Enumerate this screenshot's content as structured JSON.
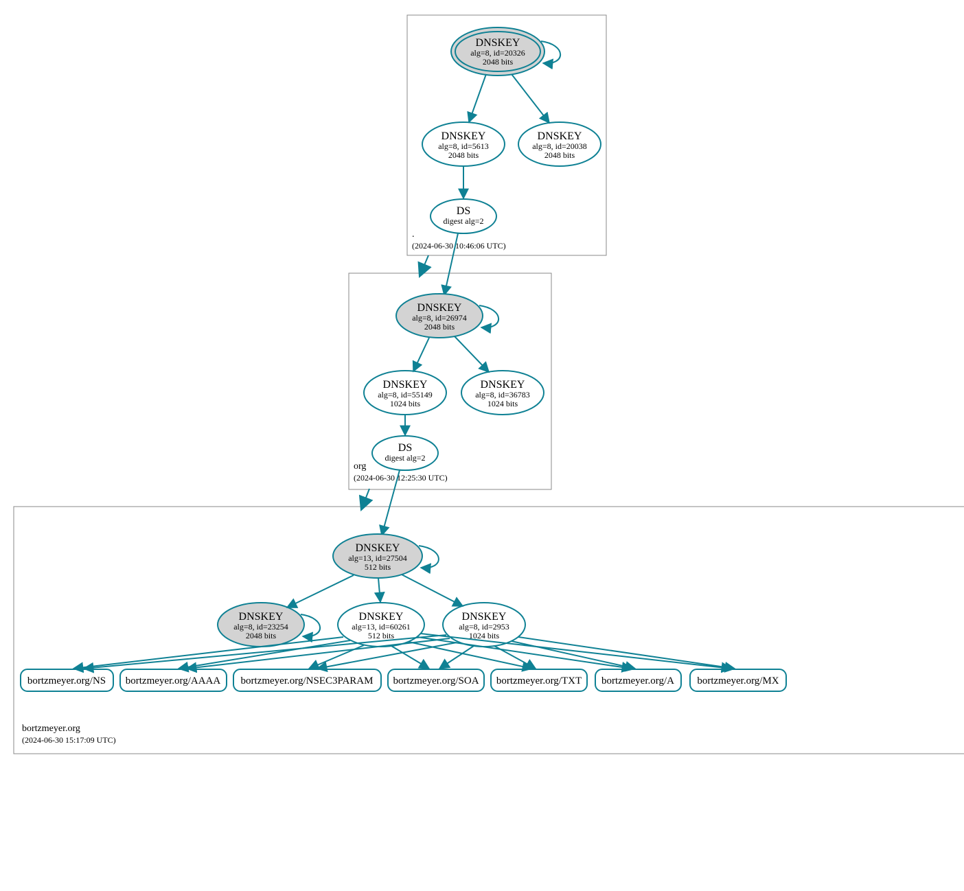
{
  "zones": {
    "root": {
      "name": ".",
      "timestamp": "(2024-06-30 10:46:06 UTC)"
    },
    "org": {
      "name": "org",
      "timestamp": "(2024-06-30 12:25:30 UTC)"
    },
    "bortzmeyer": {
      "name": "bortzmeyer.org",
      "timestamp": "(2024-06-30 15:17:09 UTC)"
    }
  },
  "nodes": {
    "root_ksk": {
      "title": "DNSKEY",
      "line1": "alg=8, id=20326",
      "line2": "2048 bits"
    },
    "root_zsk1": {
      "title": "DNSKEY",
      "line1": "alg=8, id=5613",
      "line2": "2048 bits"
    },
    "root_zsk2": {
      "title": "DNSKEY",
      "line1": "alg=8, id=20038",
      "line2": "2048 bits"
    },
    "root_ds": {
      "title": "DS",
      "line1": "digest alg=2"
    },
    "org_ksk": {
      "title": "DNSKEY",
      "line1": "alg=8, id=26974",
      "line2": "2048 bits"
    },
    "org_zsk1": {
      "title": "DNSKEY",
      "line1": "alg=8, id=55149",
      "line2": "1024 bits"
    },
    "org_zsk2": {
      "title": "DNSKEY",
      "line1": "alg=8, id=36783",
      "line2": "1024 bits"
    },
    "org_ds": {
      "title": "DS",
      "line1": "digest alg=2"
    },
    "bm_ksk": {
      "title": "DNSKEY",
      "line1": "alg=13, id=27504",
      "line2": "512 bits"
    },
    "bm_key_gray": {
      "title": "DNSKEY",
      "line1": "alg=8, id=23254",
      "line2": "2048 bits"
    },
    "bm_zsk1": {
      "title": "DNSKEY",
      "line1": "alg=13, id=60261",
      "line2": "512 bits"
    },
    "bm_zsk2": {
      "title": "DNSKEY",
      "line1": "alg=8, id=2953",
      "line2": "1024 bits"
    }
  },
  "rrsets": {
    "ns": "bortzmeyer.org/NS",
    "aaaa": "bortzmeyer.org/AAAA",
    "nsec3": "bortzmeyer.org/NSEC3PARAM",
    "soa": "bortzmeyer.org/SOA",
    "txt": "bortzmeyer.org/TXT",
    "a": "bortzmeyer.org/A",
    "mx": "bortzmeyer.org/MX"
  }
}
